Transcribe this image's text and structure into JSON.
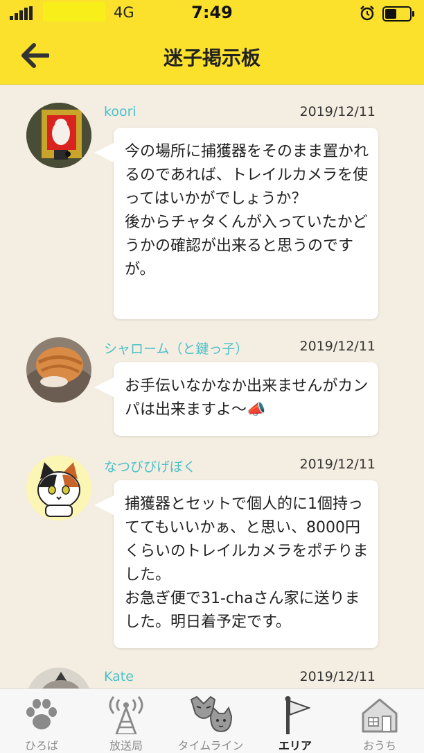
{
  "status_bar": {
    "network": "4G",
    "time": "7:49"
  },
  "header": {
    "title": "迷子掲示板"
  },
  "posts": [
    {
      "username": "koori",
      "date": "2019/12/11",
      "message": "今の場所に捕獲器をそのまま置かれるのであれば、トレイルカメラを使ってはいかがでしょうか？\n後からチャタくんが入っていたかどうかの確認が出来ると思うのですが。"
    },
    {
      "username": "シャローム（と鍵っ子）",
      "date": "2019/12/11",
      "message": "お手伝いなかなか出来ませんがカンパは出来ますよ〜📣"
    },
    {
      "username": "なつびびげぼく",
      "date": "2019/12/11",
      "message": "捕獲器とセットで個人的に1個持っててもいいかぁ、と思い、8000円くらいのトレイルカメラをポチりました。\nお急ぎ便で31-chaさん家に送りました。明日着予定です。"
    },
    {
      "username": "Kate",
      "date": "2019/12/11",
      "message": ""
    }
  ],
  "tabs": [
    {
      "label": "ひろば",
      "icon": "paw-icon"
    },
    {
      "label": "放送局",
      "icon": "broadcast-tower-icon"
    },
    {
      "label": "タイムライン",
      "icon": "cat-dog-faces-icon"
    },
    {
      "label": "エリア",
      "icon": "flag-icon"
    },
    {
      "label": "おうち",
      "icon": "house-icon"
    }
  ],
  "active_tab": "エリア",
  "colors": {
    "header_bg": "#fbe12c",
    "page_bg": "#f4ede1",
    "username": "#4cc0c8"
  }
}
